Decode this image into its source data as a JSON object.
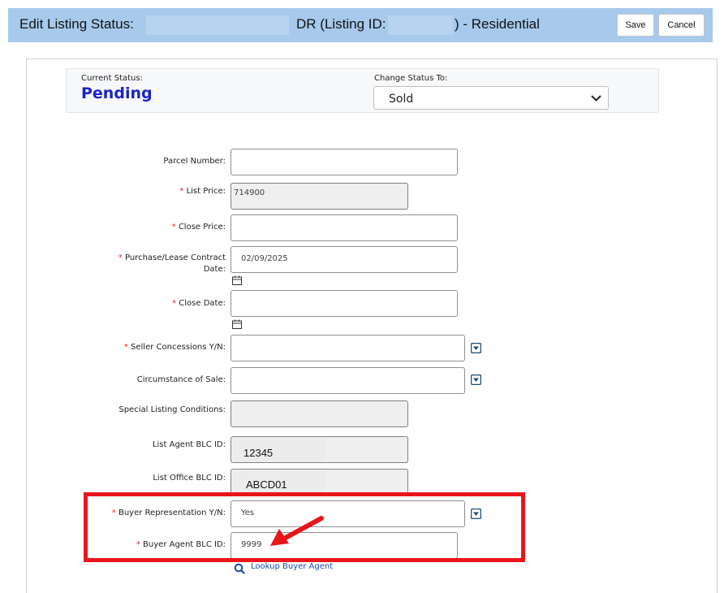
{
  "header": {
    "prefix": "Edit Listing Status:",
    "middle": "DR (Listing ID:",
    "suffix": ") - Residential",
    "save_label": "Save",
    "cancel_label": "Cancel"
  },
  "status": {
    "current_label": "Current Status:",
    "current_value": "Pending",
    "change_label": "Change Status To:",
    "change_value": "Sold"
  },
  "fields": {
    "parcel_number": {
      "label": "Parcel Number:",
      "value": ""
    },
    "list_price": {
      "label": "List Price:",
      "value": "714900"
    },
    "close_price": {
      "label": "Close Price:",
      "value": ""
    },
    "contract_date": {
      "label_line1": "Purchase/Lease Contract",
      "label_line2": "Date:",
      "value": "02/09/2025"
    },
    "close_date": {
      "label": "Close Date:",
      "value": ""
    },
    "seller_concessions": {
      "label": "Seller Concessions Y/N:",
      "value": ""
    },
    "circumstance_of_sale": {
      "label": "Circumstance of Sale:",
      "value": ""
    },
    "special_listing_conditions": {
      "label": "Special Listing Conditions:",
      "value": ""
    },
    "list_agent_blc_id": {
      "label": "List Agent BLC ID:",
      "value": "12345"
    },
    "list_office_blc_id": {
      "label": "List Office BLC ID:",
      "value": "ABCD01"
    },
    "buyer_representation": {
      "label": "Buyer Representation Y/N:",
      "value": "Yes"
    },
    "buyer_agent_blc_id": {
      "label": "Buyer Agent BLC ID:",
      "value": "9999"
    }
  },
  "required_marker": "*",
  "lookup_label": "Lookup Buyer Agent",
  "colors": {
    "header_bg": "#a6c9ec",
    "pending_text": "#1a23c7",
    "required": "#e0282d",
    "highlight": "#e8161b",
    "dropdown_icon": "#1f4e79"
  }
}
